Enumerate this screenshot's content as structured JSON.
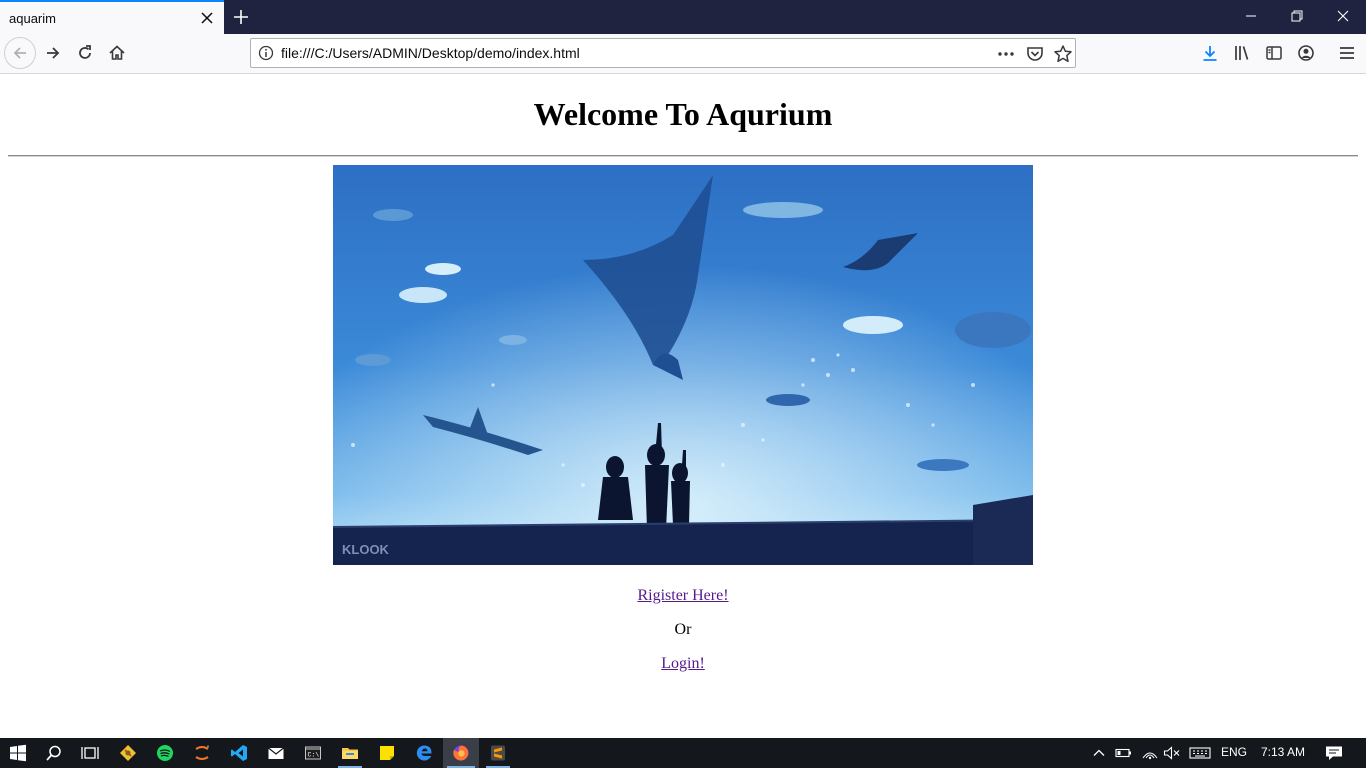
{
  "browser": {
    "tab": {
      "title": "aquarim"
    },
    "url": "file:///C:/Users/ADMIN/Desktop/demo/index.html",
    "accent_color": "#0a84ff",
    "titlebar_color": "#202340"
  },
  "page": {
    "heading": "Welcome To Aqurium",
    "image": {
      "watermark": "KLOOK"
    },
    "register_link": "Rigister Here!",
    "or_text": "Or",
    "login_link": "Login!",
    "link_color": "#551a8b"
  },
  "taskbar": {
    "apps": [
      "start",
      "search",
      "task-view",
      "git",
      "spotify",
      "jupyter",
      "vscode",
      "mail",
      "terminal",
      "file-explorer",
      "sticky-notes",
      "edge",
      "firefox",
      "sublime-text"
    ],
    "language": "ENG",
    "time": "7:13 AM"
  }
}
